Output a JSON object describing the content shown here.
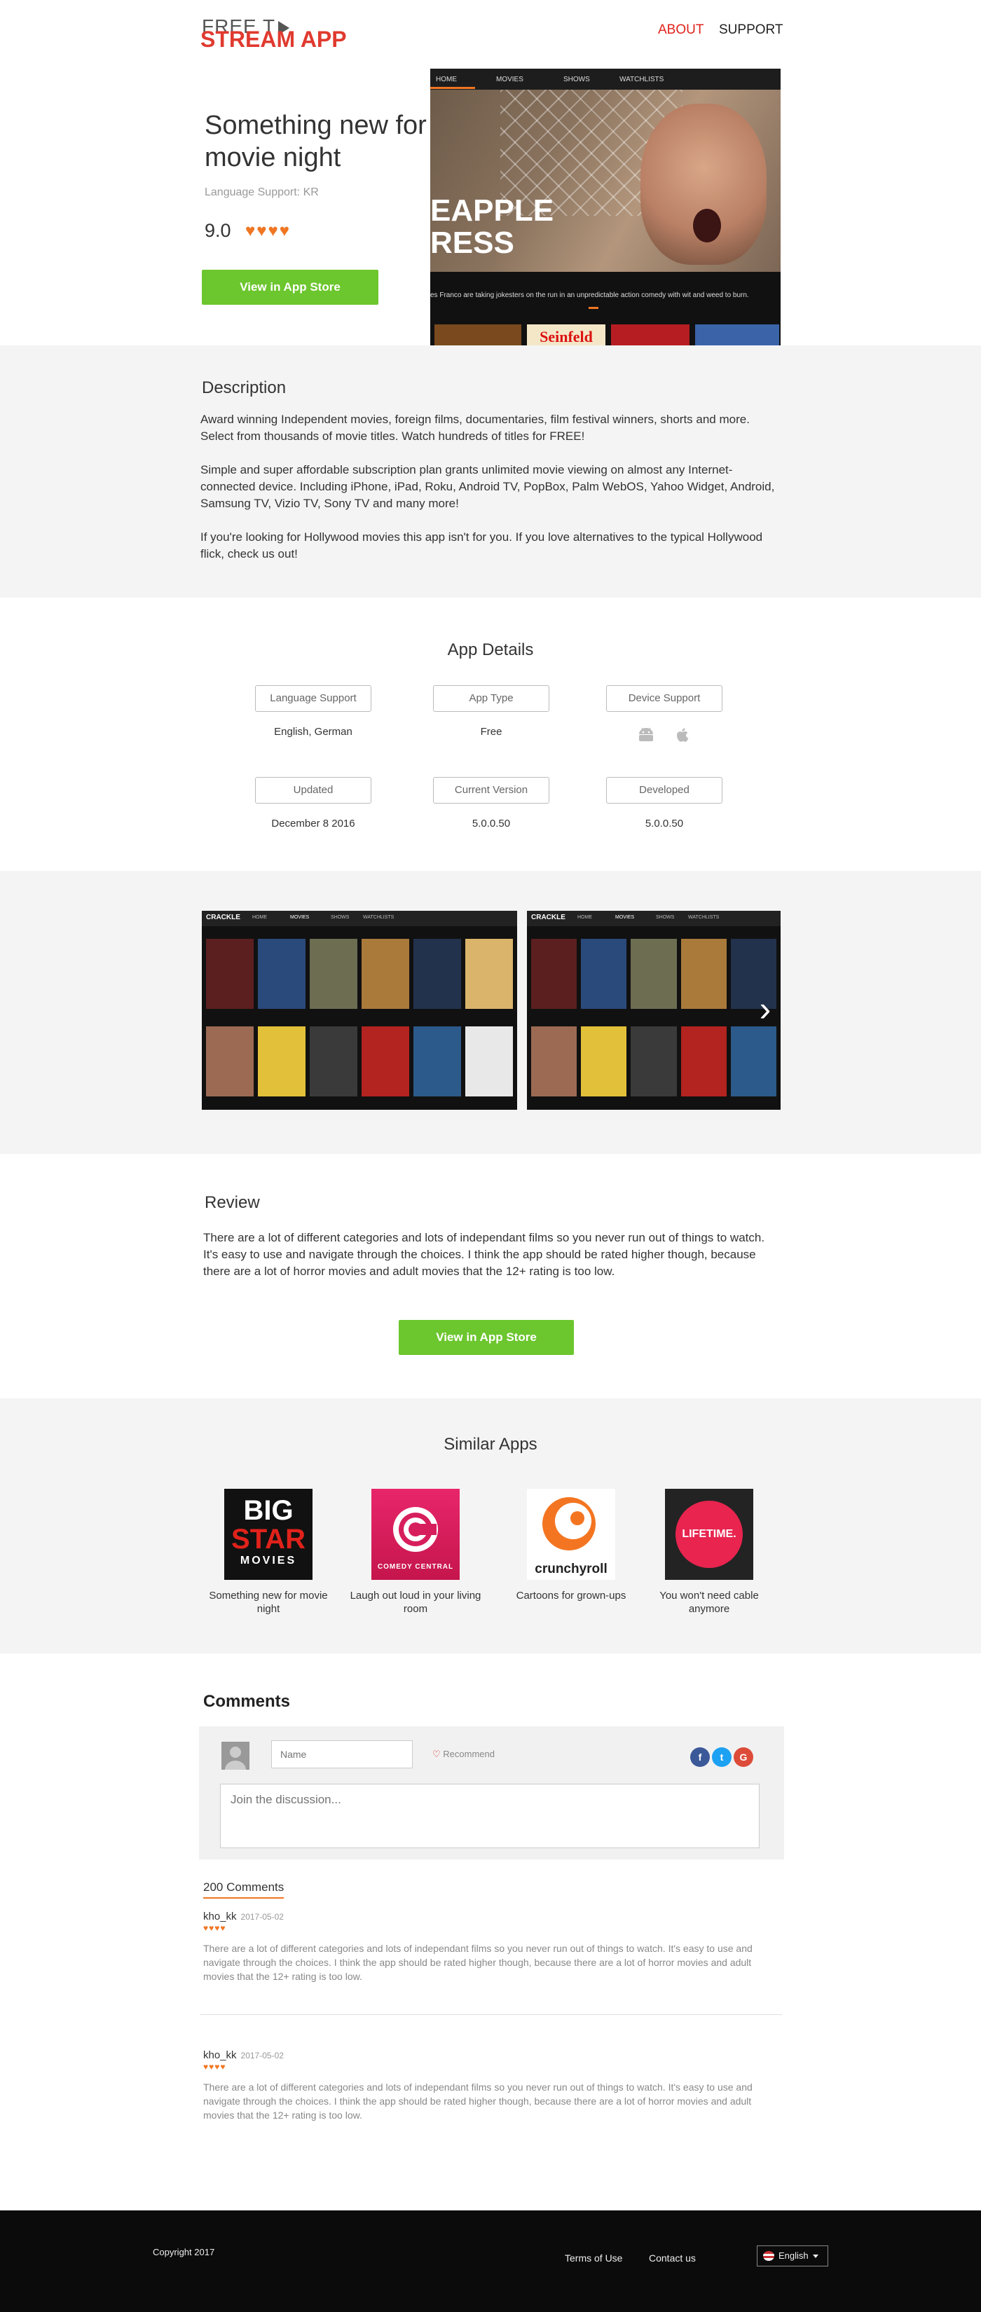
{
  "header": {
    "logo_line1": "FREE T",
    "logo_line2": "STREAM APP",
    "nav": [
      "ABOUT",
      "SUPPORT"
    ]
  },
  "hero": {
    "title": "Something new for movie night",
    "language": "Language Support: KR",
    "rating": "9.0",
    "hearts": "♥♥♥♥",
    "button": "View in App Store",
    "screenshot": {
      "tabs": [
        "HOME",
        "MOVIES",
        "SHOWS",
        "WATCHLISTS"
      ],
      "title": "EAPPLE\nRESS",
      "caption": "es Franco are taking jokesters on the run in an unpredictable action comedy with wit and weed to burn.",
      "poster_label": "Seinfeld"
    }
  },
  "description": {
    "heading": "Description",
    "paragraphs": [
      "Award winning Independent movies, foreign films, documentaries, film festival winners, shorts and more. Select from thousands of movie titles. Watch hundreds of titles for FREE!",
      "Simple and super affordable subscription plan grants unlimited movie viewing on almost any Internet-connected device. Including iPhone, iPad, Roku, Android TV, PopBox, Palm WebOS, Yahoo Widget, Android, Samsung TV, Vizio TV, Sony TV and many more!",
      "If you're looking for Hollywood movies this app isn't for you. If you love alternatives to the typical Hollywood flick, check us out!"
    ]
  },
  "details": {
    "heading": "App Details",
    "items": [
      {
        "label": "Language Support",
        "value": "English, German"
      },
      {
        "label": "App Type",
        "value": "Free"
      },
      {
        "label": "Device Support",
        "value": ""
      },
      {
        "label": "Updated",
        "value": "December 8 2016"
      },
      {
        "label": "Current Version",
        "value": "5.0.0.50"
      },
      {
        "label": "Developed",
        "value": "5.0.0.50"
      }
    ]
  },
  "gallery": {
    "brand": "CRACKLE",
    "tabs": [
      "HOME",
      "MOVIES",
      "SHOWS",
      "WATCHLISTS"
    ]
  },
  "review": {
    "heading": "Review",
    "text": "There are a lot of different categories and lots of independant films so you never run out of things to watch. It's easy to use and navigate through the choices. I think the app should be rated higher though, because there are a lot of horror movies and adult movies that the 12+ rating is too low.",
    "button": "View in App Store"
  },
  "similar": {
    "heading": "Similar Apps",
    "apps": [
      {
        "icon_text": [
          "BIG",
          "STAR",
          "MOVIES"
        ],
        "caption": "Something new for movie night"
      },
      {
        "icon_text": [
          "COMEDY CENTRAL"
        ],
        "caption": "Laugh out loud in your living room"
      },
      {
        "icon_text": [
          "crunchyroll"
        ],
        "caption": "Cartoons for grown-ups"
      },
      {
        "icon_text": [
          "LIFETIME."
        ],
        "caption": "You won't need cable anymore"
      }
    ]
  },
  "comments": {
    "heading": "Comments",
    "name_placeholder": "Name",
    "recommend": "Recommend",
    "discussion_placeholder": "Join the discussion...",
    "count": "200 Comments",
    "list": [
      {
        "author": "kho_kk",
        "date": "2017-05-02",
        "hearts": "♥♥♥♥",
        "text": "There are a lot of different categories and lots of independant films so you never run out of things to watch. It's easy to use and navigate through the choices. I think the app should be rated higher though, because there are a lot of horror movies and adult movies that the 12+ rating is too low."
      },
      {
        "author": "kho_kk",
        "date": "2017-05-02",
        "hearts": "♥♥♥♥",
        "text": "There are a lot of different categories and lots of independant films so you never run out of things to watch. It's easy to use and navigate through the choices. I think the app should be rated higher though, because there are a lot of horror movies and adult movies that the 12+ rating is too low."
      }
    ]
  },
  "footer": {
    "copyright": "Copyright 2017",
    "terms": "Terms of Use",
    "contact": "Contact us",
    "language": "English"
  },
  "colors": {
    "accent_red": "#e0221b",
    "accent_orange": "#f07622",
    "button_green": "#6cc62e"
  }
}
